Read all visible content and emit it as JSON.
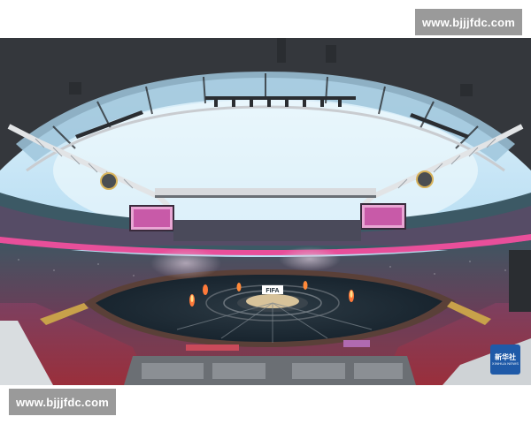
{
  "watermark": {
    "top_text": "www.bjjjfdc.com",
    "bottom_text": "www.bjjjfdc.com"
  },
  "photo": {
    "subject": "stadium-opening-ceremony",
    "stage_sign": "FIFA"
  },
  "agency_logo": {
    "chinese": "新华社",
    "english": "XINHUA NEWS"
  },
  "colors": {
    "sky": "#c9e9f7",
    "roof": "#3a3d42",
    "pitch": "#1c2a33",
    "crowd": "#7a3a55",
    "accent_pink": "#e84f9a"
  }
}
